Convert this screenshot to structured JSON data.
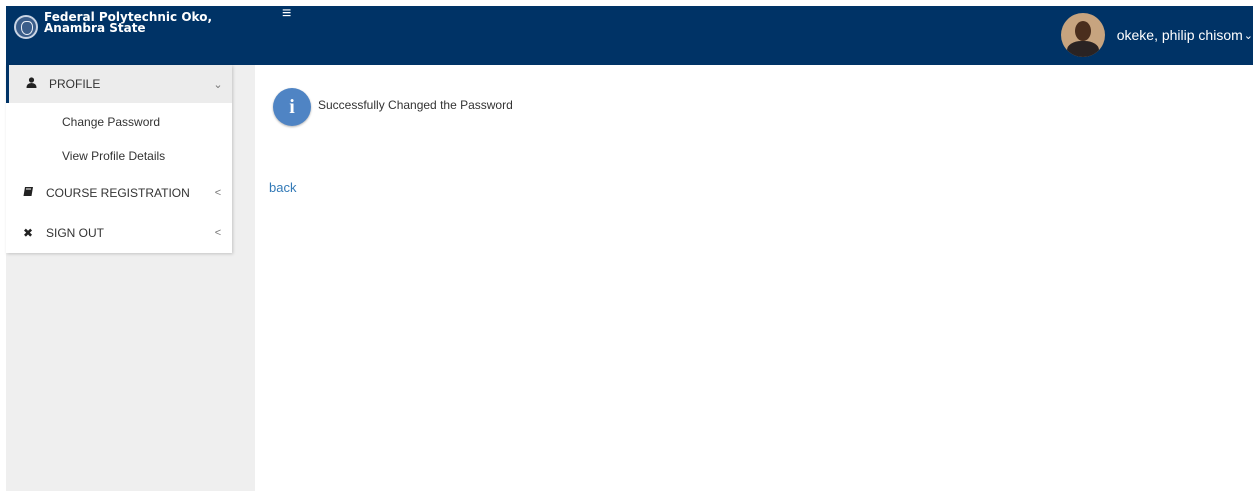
{
  "header": {
    "title_line1": "Federal Polytechnic Oko,",
    "title_line2": "Anambra State",
    "menu_toggle": "≡",
    "user_name": "okeke, philip chisom"
  },
  "sidebar": {
    "items": [
      {
        "icon": "user-icon",
        "label": "PROFILE",
        "chevron": "chevron-down-icon"
      },
      {
        "icon": "book-icon",
        "label": "COURSE REGISTRATION",
        "chevron": "chevron-left-icon"
      },
      {
        "icon": "close-icon",
        "label": "SIGN OUT",
        "chevron": "chevron-left-icon"
      }
    ],
    "profile_subitems": [
      "Change Password",
      "View Profile Details"
    ]
  },
  "main": {
    "message": "Successfully Changed the Password",
    "back_link": "back"
  },
  "colors": {
    "header_bg": "#003366",
    "info_icon": "#4f84c4",
    "link": "#337ab7",
    "sidebar_bg": "#efefef"
  }
}
